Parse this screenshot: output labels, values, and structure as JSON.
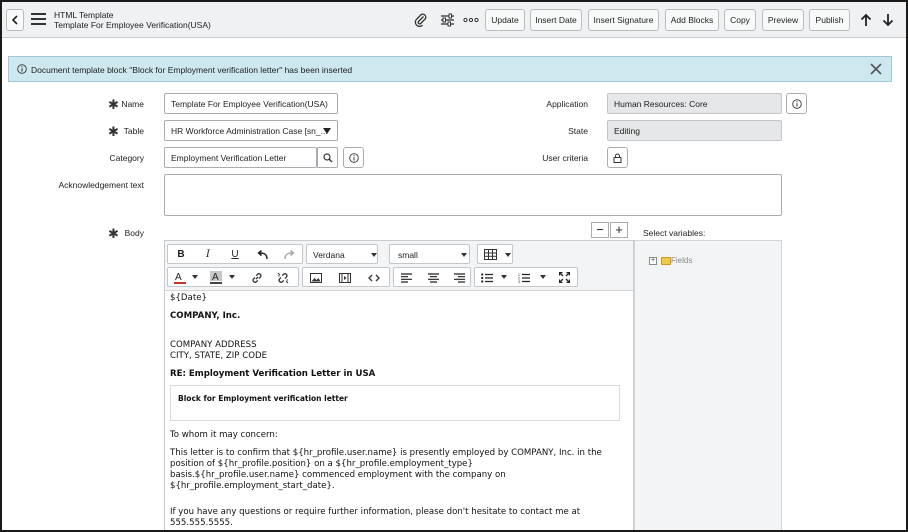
{
  "header": {
    "title": "HTML Template",
    "subtitle": "Template For Employee Verification(USA)",
    "buttons": {
      "update": "Update",
      "insert_date": "Insert Date",
      "insert_signature": "Insert Signature",
      "add_blocks": "Add Blocks",
      "copy": "Copy",
      "preview": "Preview",
      "publish": "Publish"
    }
  },
  "banner": {
    "message": "Document template block \"Block for Employment verification letter\" has been inserted"
  },
  "form": {
    "name_label": "Name",
    "name_value": "Template For Employee Verification(USA)",
    "table_label": "Table",
    "table_value": "HR Workforce Administration Case [sn_...",
    "category_label": "Category",
    "category_value": "Employment Verification Letter",
    "ack_label": "Acknowledgement text",
    "ack_value": "",
    "body_label": "Body",
    "application_label": "Application",
    "application_value": "Human Resources: Core",
    "state_label": "State",
    "state_value": "Editing",
    "user_criteria_label": "User criteria"
  },
  "editor": {
    "font_family": "Verdana",
    "font_size": "small",
    "content": {
      "line1": "${Date}",
      "line2": "COMPANY, Inc.",
      "line3": "COMPANY ADDRESS",
      "line4": "CITY, STATE, ZIP CODE",
      "line5": "RE: Employment Verification Letter in USA",
      "block": "Block for Employment verification letter",
      "line6": "To whom it may concern:",
      "para1_l1": "This letter is to confirm that ${hr_profile.user.name} is presently employed by COMPANY, Inc. in the",
      "para1_l2": "position of ${hr_profile.position} on a ${hr_profile.employment_type}",
      "para1_l3": "basis.${hr_profile.user.name} commenced employment with the company on",
      "para1_l4": "${hr_profile.employment_start_date}.",
      "para2_l1": "If you have any questions or require further information, please don't hesitate to contact me at",
      "para2_l2": "555.555.5555."
    }
  },
  "variables": {
    "label": "Select variables:",
    "tree_root": "Fields"
  }
}
